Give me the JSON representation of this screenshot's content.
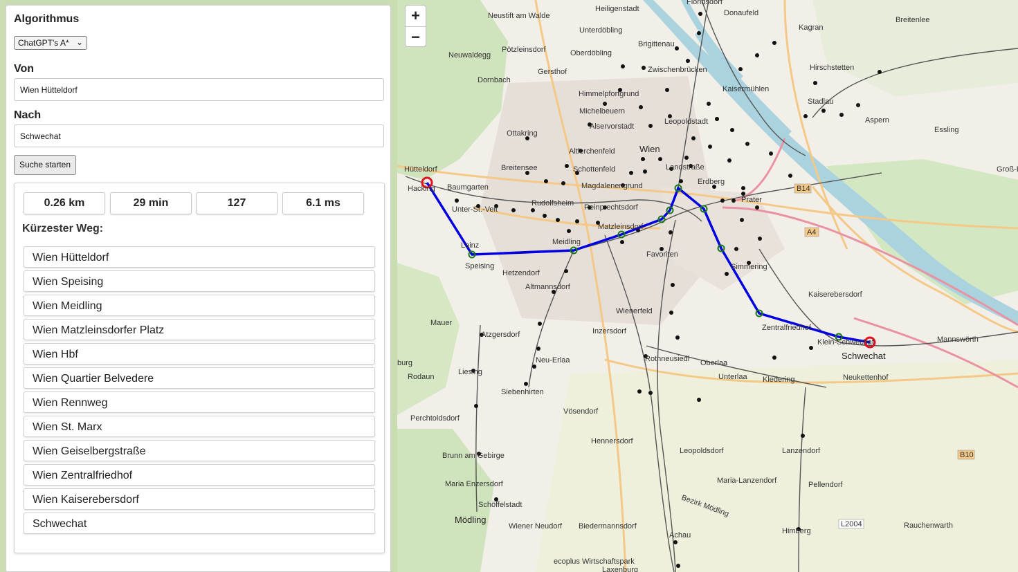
{
  "sidebar": {
    "algorithm_label": "Algorithmus",
    "algorithm_selected": "ChatGPT's A*",
    "from_label": "Von",
    "from_value": "Wien Hütteldorf",
    "to_label": "Nach",
    "to_value": "Schwechat",
    "search_button": "Suche starten"
  },
  "results": {
    "distance": "0.26 km",
    "duration": "29 min",
    "nodes": "127",
    "runtime": "6.1 ms",
    "path_title": "Kürzester Weg:",
    "path": [
      "Wien Hütteldorf",
      "Wien Speising",
      "Wien Meidling",
      "Wien Matzleinsdorfer Platz",
      "Wien Hbf",
      "Wien Quartier Belvedere",
      "Wien Rennweg",
      "Wien St. Marx",
      "Wien Geiselbergstraße",
      "Wien Zentralfriedhof",
      "Wien Kaiserebersdorf",
      "Schwechat"
    ]
  },
  "map": {
    "zoom_in": "+",
    "zoom_out": "−",
    "route_color": "#0000e0",
    "endpoint_color": "#e01020",
    "waypoint_color": "#1a7a1a",
    "place_labels": [
      "Floridsdorf",
      "Heiligenstadt",
      "Neustift am Walde",
      "Donaufeld",
      "Kagran",
      "Breitenlee",
      "Unterdöbling",
      "Pötzleinsdorf",
      "Neuwaldegg",
      "Oberdöbling",
      "Brigittenau",
      "Zwischenbrücken",
      "Hirschstetten",
      "Gersthof",
      "Kaisermühlen",
      "Dornbach",
      "Himmelpfortgrund",
      "Stadlau",
      "Michelbeuern",
      "Alservorstadt",
      "Leopoldstadt",
      "Ottakring",
      "Aspern",
      "Essling",
      "Altlerchenfeld",
      "Wien",
      "Breitensee",
      "Hütteldorf",
      "Schottenfeld",
      "Landstraße",
      "Groß-Enz",
      "Erdberg",
      "Hacking",
      "Baumgarten",
      "Magdalenengrund",
      "Unter-St.-Veit",
      "Rudolfsheim",
      "Reinprechtsdorf",
      "Lainz",
      "Matzleinsdorf",
      "Meidling",
      "Speising",
      "Favoriten",
      "Simmering",
      "Hetzendorf",
      "Altmannsdorf",
      "Kaiserebersdorf",
      "Wienerfeld",
      "Mauer",
      "Inzersdorf",
      "Atzgersdorf",
      "Zentralfriedhof",
      "Klein-Schwechat",
      "Mannswörth",
      "Schwechat",
      "Neu-Erlaa",
      "Rothneusiedl",
      "Oberlaa",
      "Rodaun",
      "Liesing",
      "Unterlaa",
      "Kledering",
      "Neukettenhof",
      "Siebenhirten",
      "Perchtoldsdorf",
      "Vösendorf",
      "Hennersdorf",
      "Leopoldsdorf",
      "Lanzendorf",
      "Brunn am Gebirge",
      "Maria Enzersdorf",
      "Maria-Lanzendorf",
      "Pellendorf",
      "Schöffelstadt",
      "Mödling",
      "Wiener Neudorf",
      "Biedermannsdorf",
      "Himberg",
      "Rauchenwarth",
      "Achau",
      "Laxenburg",
      "Bezirk Mödling",
      "ecoplus Wirtschaftspark",
      "Prater",
      "burg"
    ],
    "road_labels": [
      "B14",
      "A4",
      "B10",
      "L2004"
    ]
  }
}
